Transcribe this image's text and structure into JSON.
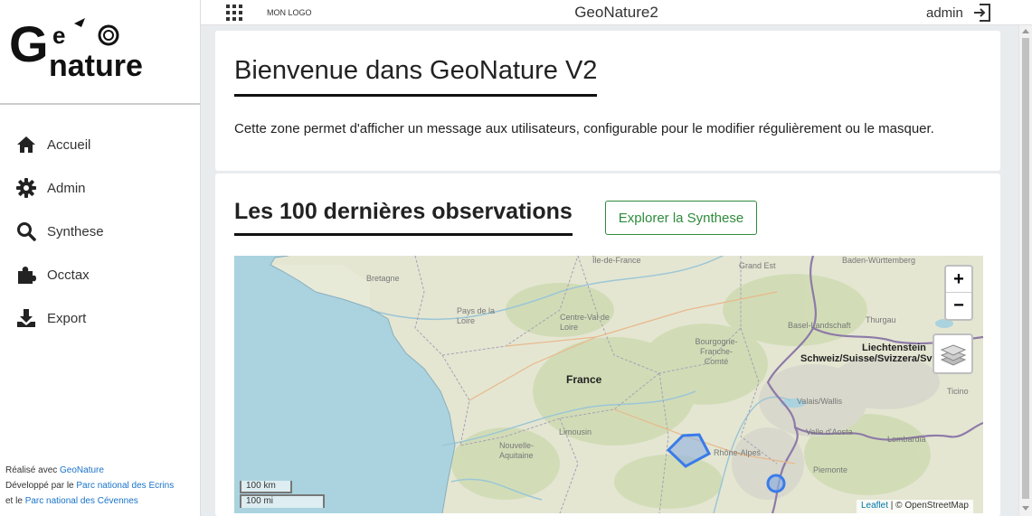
{
  "sidebar": {
    "logo_text": "GeoNature",
    "items": [
      {
        "label": "Accueil",
        "icon": "home-icon"
      },
      {
        "label": "Admin",
        "icon": "gear-icon"
      },
      {
        "label": "Synthese",
        "icon": "search-icon"
      },
      {
        "label": "Occtax",
        "icon": "puzzle-icon"
      },
      {
        "label": "Export",
        "icon": "download-icon"
      }
    ],
    "footer": {
      "line1_prefix": "Réalisé avec ",
      "line1_link": "GeoNature",
      "line2_prefix": "Développé par le ",
      "line2_link": "Parc national des Ecrins",
      "line3_prefix": "et le ",
      "line3_link": "Parc national des Cévennes"
    }
  },
  "topbar": {
    "apps_icon": "grid-icon",
    "mon_logo": "MON LOGO",
    "title": "GeoNature2",
    "user": "admin",
    "logout_icon": "logout-icon"
  },
  "welcome": {
    "title": "Bienvenue dans GeoNature V2",
    "message": "Cette zone permet d'afficher un message aux utilisateurs, configurable pour le modifier régulièrement ou le masquer."
  },
  "observations": {
    "title": "Les 100 dernières observations",
    "explore_button": "Explorer la Synthese"
  },
  "map": {
    "zoom_in": "+",
    "zoom_out": "−",
    "layers_icon": "layers-icon",
    "scale_km": "100 km",
    "scale_mi": "100 mi",
    "attribution_link": "Leaflet",
    "attribution_text": " | © OpenStreetMap",
    "labels": {
      "ile_de_france": "Île-de-France",
      "grand_est": "Grand Est",
      "baden": "Baden-Württemberg",
      "bretagne": "Bretagne",
      "pays_de_la_loire": "Pays de la Loire",
      "centre": "Centre-Val de Loire",
      "bourgogne": "Bourgogne-Franche-Comté",
      "basel": "Basel-Landschaft",
      "thurgau": "Thurgau",
      "france": "France",
      "liechtenstein": "Liechtenstein",
      "suisse": "Schweiz/Suisse/Svizzera/Svizra",
      "limousin": "Limousin",
      "valais": "Valais/Wallis",
      "ticino": "Ticino",
      "aosta": "Valle d'Aosta",
      "lombardia": "Lombardia",
      "nouvelle_aquitaine": "Nouvelle-Aquitaine",
      "rhone_alpes": "Rhône-Alpes",
      "piemonte": "Piemonte"
    }
  }
}
